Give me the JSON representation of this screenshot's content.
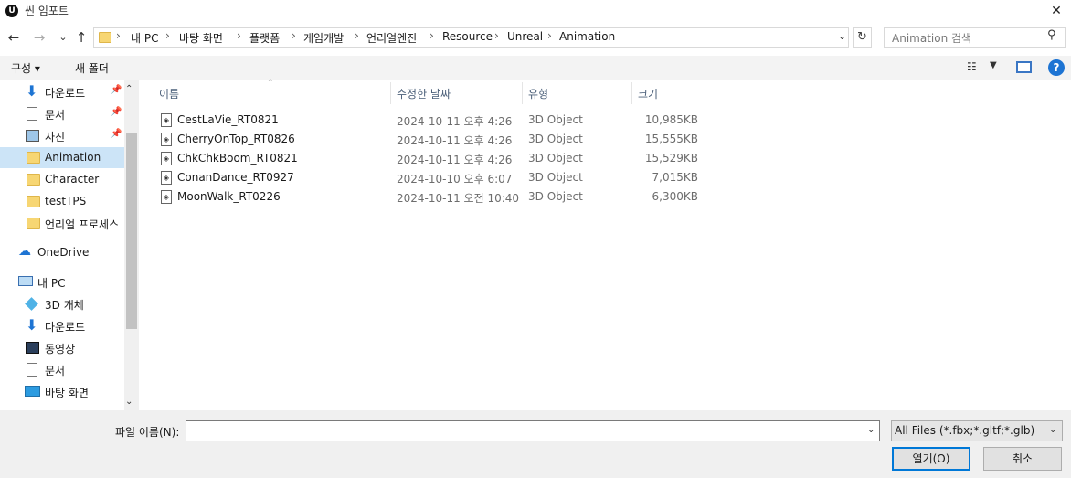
{
  "window": {
    "title": "씬 임포트",
    "close_glyph": "✕"
  },
  "nav_buttons": {
    "back": "←",
    "forward": "→",
    "recent": "⌄",
    "up": "↑"
  },
  "address": {
    "crumbs": [
      "내 PC",
      "바탕 화면",
      "플랫폼",
      "게임개발",
      "언리얼엔진",
      "Resource",
      "Unreal",
      "Animation"
    ],
    "separator": "›"
  },
  "search": {
    "placeholder": "Animation 검색"
  },
  "toolbar": {
    "organize": "구성 ▾",
    "new_folder": "새 폴더"
  },
  "sidebar": {
    "items": [
      {
        "label": "다운로드",
        "icon": "download-arrow-icon",
        "pinned": true
      },
      {
        "label": "문서",
        "icon": "document-icon",
        "pinned": true
      },
      {
        "label": "사진",
        "icon": "pictures-icon",
        "pinned": true
      },
      {
        "label": "Animation",
        "icon": "folder-icon",
        "selected": true
      },
      {
        "label": "Character",
        "icon": "folder-icon"
      },
      {
        "label": "testTPS",
        "icon": "folder-icon"
      },
      {
        "label": "언리얼 프로세스",
        "icon": "folder-icon"
      },
      {
        "label": "OneDrive",
        "icon": "cloud-icon",
        "top_level": true
      },
      {
        "label": "내 PC",
        "icon": "computer-icon",
        "top_level": true
      },
      {
        "label": "3D 개체",
        "icon": "3d-objects-icon"
      },
      {
        "label": "다운로드",
        "icon": "download-arrow-icon"
      },
      {
        "label": "동영상",
        "icon": "video-icon"
      },
      {
        "label": "문서",
        "icon": "document-icon"
      },
      {
        "label": "바탕 화면",
        "icon": "desktop-icon"
      }
    ]
  },
  "columns": {
    "name": "이름",
    "modified": "수정한 날짜",
    "type": "유형",
    "size": "크기"
  },
  "files": [
    {
      "name": "CestLaVie_RT0821",
      "modified": "2024-10-11 오후 4:26",
      "type": "3D Object",
      "size": "10,985KB"
    },
    {
      "name": "CherryOnTop_RT0826",
      "modified": "2024-10-11 오후 4:26",
      "type": "3D Object",
      "size": "15,555KB"
    },
    {
      "name": "ChkChkBoom_RT0821",
      "modified": "2024-10-11 오후 4:26",
      "type": "3D Object",
      "size": "15,529KB"
    },
    {
      "name": "ConanDance_RT0927",
      "modified": "2024-10-10 오후 6:07",
      "type": "3D Object",
      "size": "7,015KB"
    },
    {
      "name": "MoonWalk_RT0226",
      "modified": "2024-10-11 오전 10:40",
      "type": "3D Object",
      "size": "6,300KB"
    }
  ],
  "footer": {
    "filename_label": "파일 이름(N):",
    "filename_value": "",
    "filetype_selected": "All Files (*.fbx;*.gltf;*.glb)",
    "open_button": "열기(O)",
    "cancel_button": "취소"
  },
  "colors": {
    "selection": "#cce4f7",
    "accent": "#0078d7",
    "folder": "#f7d673"
  }
}
